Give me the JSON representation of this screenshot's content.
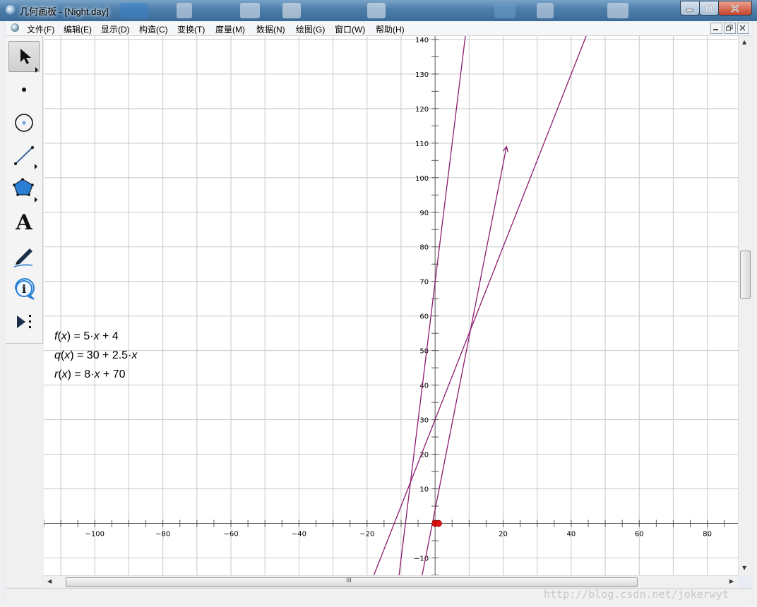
{
  "window": {
    "title": "几何画板 - [Night.day]"
  },
  "menu": {
    "items": [
      {
        "label": "文件(F)",
        "key": "file"
      },
      {
        "label": "编辑(E)",
        "key": "edit"
      },
      {
        "label": "显示(D)",
        "key": "display"
      },
      {
        "label": "构造(C)",
        "key": "construct"
      },
      {
        "label": "变换(T)",
        "key": "transform"
      },
      {
        "label": "度量(M)",
        "key": "measure"
      },
      {
        "label": "数据(N)",
        "key": "data"
      },
      {
        "label": "绘图(G)",
        "key": "graph"
      },
      {
        "label": "窗口(W)",
        "key": "window"
      },
      {
        "label": "帮助(H)",
        "key": "help"
      }
    ]
  },
  "toolbox": {
    "tools": [
      {
        "name": "arrow-select-tool",
        "icon": "arrow-icon"
      },
      {
        "name": "point-tool",
        "icon": "point-icon"
      },
      {
        "name": "compass-tool",
        "icon": "compass-icon"
      },
      {
        "name": "straightedge-tool",
        "icon": "segment-icon"
      },
      {
        "name": "polygon-tool",
        "icon": "polygon-icon"
      },
      {
        "name": "text-tool",
        "icon": "text-a-icon",
        "glyph": "A"
      },
      {
        "name": "marker-tool",
        "icon": "marker-icon"
      },
      {
        "name": "information-tool",
        "icon": "info-icon"
      },
      {
        "name": "custom-tool",
        "icon": "custom-tools-icon"
      }
    ]
  },
  "functions": [
    {
      "name": "f",
      "arg": "x",
      "rhs_before": " = 5·",
      "rhs_var": "x",
      "rhs_after": " + 4"
    },
    {
      "name": "q",
      "arg": "x",
      "rhs_before": " = 30 + 2.5·",
      "rhs_var": "x",
      "rhs_after": ""
    },
    {
      "name": "r",
      "arg": "x",
      "rhs_before": " = 8·",
      "rhs_var": "x",
      "rhs_after": " + 70"
    }
  ],
  "hscroll_label": "III",
  "watermark": "http://blog.csdn.net/jokerwyt",
  "colors": {
    "curve": "#8b1a6f",
    "grid": "#c8c8c8",
    "point": "#e01010"
  },
  "chart_data": {
    "type": "line",
    "title": "",
    "xlabel": "",
    "ylabel": "",
    "xlim": [
      -115,
      89
    ],
    "ylim": [
      -15,
      141
    ],
    "x_ticks": [
      -100,
      -80,
      -60,
      -40,
      -20,
      20,
      40,
      60,
      80
    ],
    "y_ticks": [
      -10,
      10,
      20,
      30,
      40,
      50,
      60,
      70,
      80,
      90,
      100,
      110,
      120,
      130,
      140
    ],
    "grid": true,
    "series": [
      {
        "name": "f(x) = 5·x + 4",
        "points": [
          [
            -3.8,
            -15
          ],
          [
            8.2,
            45.0
          ],
          [
            21.0,
            109.0
          ]
        ],
        "arrow_end": true
      },
      {
        "name": "q(x) = 30 + 2.5·x",
        "points": [
          [
            -18.0,
            -15
          ],
          [
            44.4,
            141
          ]
        ]
      },
      {
        "name": "r(x) = 8·x + 70",
        "points": [
          [
            -10.6,
            -15
          ],
          [
            8.9,
            141
          ]
        ]
      }
    ],
    "points": [
      [
        0,
        0
      ],
      [
        1,
        0
      ]
    ]
  }
}
